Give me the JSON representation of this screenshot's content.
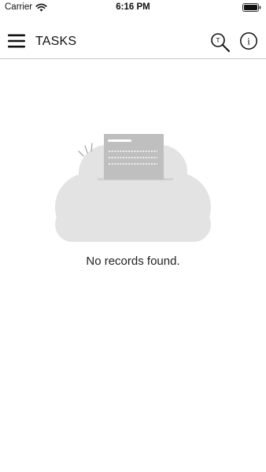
{
  "status_bar": {
    "carrier": "Carrier",
    "time": "6:16 PM",
    "icons": [
      "wifi-icon",
      "battery-icon"
    ]
  },
  "header": {
    "title": "TASKS",
    "search_icon_letter": "T",
    "info_icon_letter": "i",
    "icons": [
      "hamburger-menu-icon",
      "search-icon",
      "info-icon"
    ]
  },
  "empty_state": {
    "message": "No records found.",
    "illustration": "cloud-with-document-icon"
  },
  "colors": {
    "background": "#ffffff",
    "text": "#111111",
    "divider": "#c8c8c8",
    "cloud": "#e3e3e3",
    "document": "#bfbfbf"
  }
}
